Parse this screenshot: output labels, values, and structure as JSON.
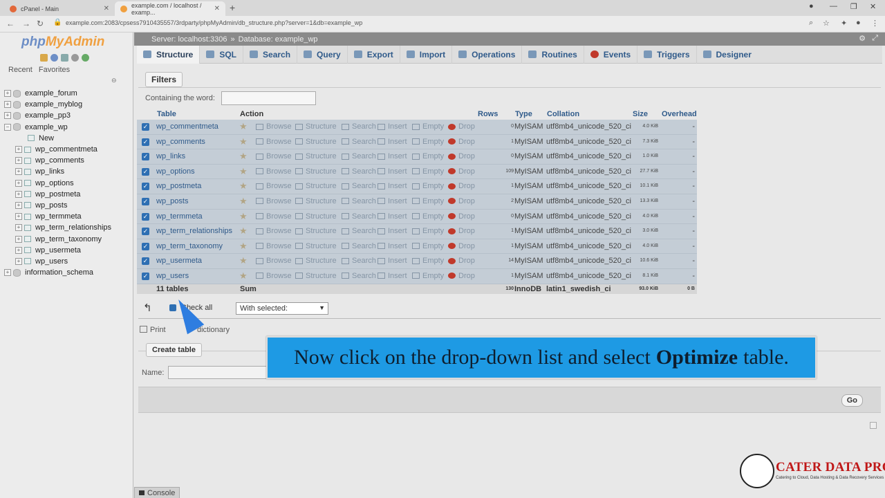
{
  "browser": {
    "tabs": [
      {
        "title": "cPanel - Main"
      },
      {
        "title": "example.com / localhost / examp..."
      }
    ],
    "new_tab": "+",
    "url": "example.com:2083/cpsess7910435557/3rdparty/phpMyAdmin/db_structure.php?server=1&db=example_wp"
  },
  "logo": {
    "php": "php",
    "myadmin": "MyAdmin"
  },
  "nav_tabs": [
    "Recent",
    "Favorites"
  ],
  "tree": {
    "databases": [
      "example_forum",
      "example_myblog",
      "example_pp3",
      "example_wp"
    ],
    "new_label": "New",
    "tables": [
      "wp_commentmeta",
      "wp_comments",
      "wp_links",
      "wp_options",
      "wp_postmeta",
      "wp_posts",
      "wp_termmeta",
      "wp_term_relationships",
      "wp_term_taxonomy",
      "wp_usermeta",
      "wp_users"
    ],
    "last_db": "information_schema"
  },
  "breadcrumb": {
    "server": "Server: localhost:3306",
    "sep": "»",
    "database": "Database: example_wp"
  },
  "menu": [
    "Structure",
    "SQL",
    "Search",
    "Query",
    "Export",
    "Import",
    "Operations",
    "Routines",
    "Events",
    "Triggers",
    "Designer"
  ],
  "filters": {
    "button": "Filters",
    "label": "Containing the word:"
  },
  "table_headers": {
    "table": "Table",
    "action": "Action",
    "rows": "Rows",
    "type": "Type",
    "collation": "Collation",
    "size": "Size",
    "overhead": "Overhead"
  },
  "actions": [
    "Browse",
    "Structure",
    "Search",
    "Insert",
    "Empty",
    "Drop"
  ],
  "rows": [
    {
      "name": "wp_commentmeta",
      "rows": "0",
      "type": "MyISAM",
      "collation": "utf8mb4_unicode_520_ci",
      "size": "4.0 KiB",
      "overhead": "-"
    },
    {
      "name": "wp_comments",
      "rows": "1",
      "type": "MyISAM",
      "collation": "utf8mb4_unicode_520_ci",
      "size": "7.3 KiB",
      "overhead": "-"
    },
    {
      "name": "wp_links",
      "rows": "0",
      "type": "MyISAM",
      "collation": "utf8mb4_unicode_520_ci",
      "size": "1.0 KiB",
      "overhead": "-"
    },
    {
      "name": "wp_options",
      "rows": "109",
      "type": "MyISAM",
      "collation": "utf8mb4_unicode_520_ci",
      "size": "27.7 KiB",
      "overhead": "-"
    },
    {
      "name": "wp_postmeta",
      "rows": "1",
      "type": "MyISAM",
      "collation": "utf8mb4_unicode_520_ci",
      "size": "10.1 KiB",
      "overhead": "-"
    },
    {
      "name": "wp_posts",
      "rows": "2",
      "type": "MyISAM",
      "collation": "utf8mb4_unicode_520_ci",
      "size": "13.3 KiB",
      "overhead": "-"
    },
    {
      "name": "wp_termmeta",
      "rows": "0",
      "type": "MyISAM",
      "collation": "utf8mb4_unicode_520_ci",
      "size": "4.0 KiB",
      "overhead": "-"
    },
    {
      "name": "wp_term_relationships",
      "rows": "1",
      "type": "MyISAM",
      "collation": "utf8mb4_unicode_520_ci",
      "size": "3.0 KiB",
      "overhead": "-"
    },
    {
      "name": "wp_term_taxonomy",
      "rows": "1",
      "type": "MyISAM",
      "collation": "utf8mb4_unicode_520_ci",
      "size": "4.0 KiB",
      "overhead": "-"
    },
    {
      "name": "wp_usermeta",
      "rows": "14",
      "type": "MyISAM",
      "collation": "utf8mb4_unicode_520_ci",
      "size": "10.6 KiB",
      "overhead": "-"
    },
    {
      "name": "wp_users",
      "rows": "1",
      "type": "MyISAM",
      "collation": "utf8mb4_unicode_520_ci",
      "size": "8.1 KiB",
      "overhead": "-"
    }
  ],
  "summary": {
    "tables": "11 tables",
    "sum": "Sum",
    "rows": "130",
    "type": "InnoDB",
    "collation": "latin1_swedish_ci",
    "size": "93.0 KiB",
    "overhead": "0 B"
  },
  "check_all": "Check all",
  "with_selected": "With selected:",
  "print": "Print",
  "dictionary": "dictionary",
  "create_table": {
    "button": "Create table",
    "name_label": "Name:",
    "go": "Go"
  },
  "console": "Console",
  "caption": {
    "before": "Now click on the drop-down list and select",
    "bold": "Optimize",
    "after": "table."
  },
  "watermark": {
    "title": "CATER DATA PRO",
    "subtitle": "Catering to Cloud, Data Hosting & Data Recovery Services"
  }
}
